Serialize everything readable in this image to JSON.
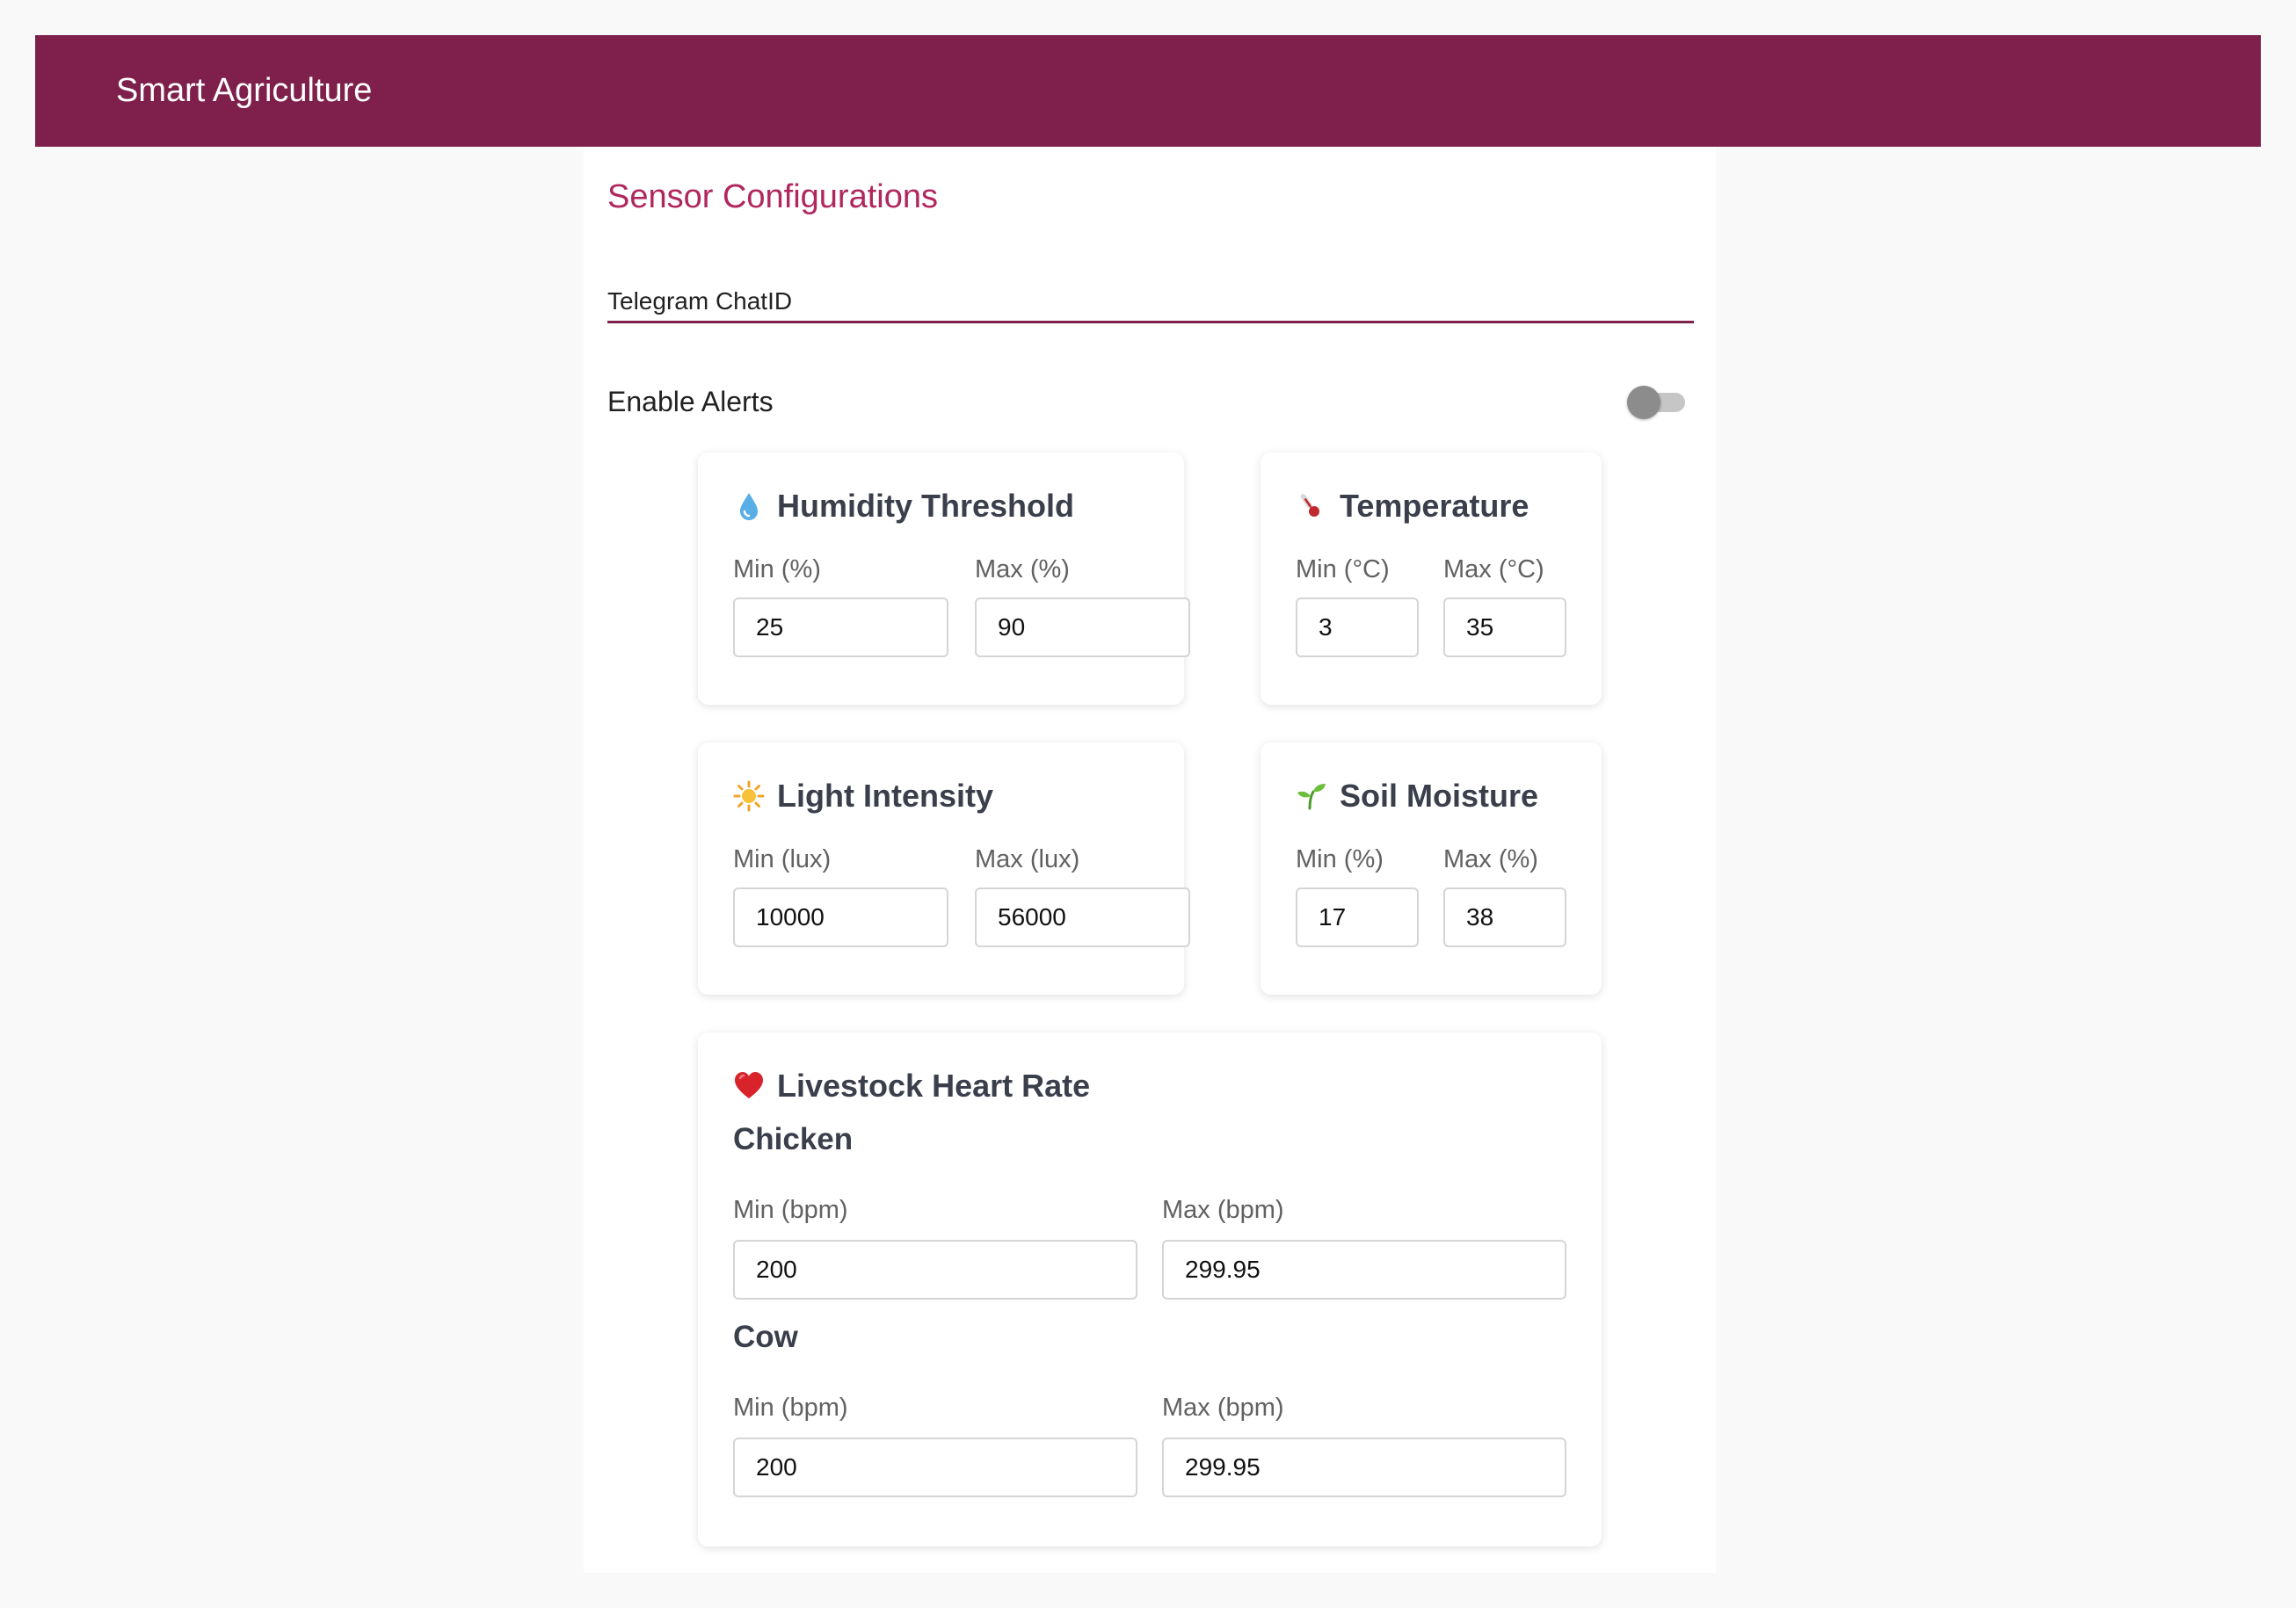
{
  "appbar": {
    "title": "Smart Agriculture"
  },
  "page": {
    "title": "Sensor Configurations"
  },
  "telegram": {
    "label": "Telegram ChatID",
    "value": ""
  },
  "alerts": {
    "label": "Enable Alerts",
    "enabled": false
  },
  "cards": {
    "humidity": {
      "icon": "droplet-icon",
      "title": "Humidity Threshold",
      "min_label": "Min (%)",
      "min_value": "25",
      "max_label": "Max (%)",
      "max_value": "90"
    },
    "temperature": {
      "icon": "thermometer-icon",
      "title": "Temperature",
      "min_label": "Min (°C)",
      "min_value": "3",
      "max_label": "Max (°C)",
      "max_value": "35"
    },
    "light": {
      "icon": "sun-icon",
      "title": "Light Intensity",
      "min_label": "Min (lux)",
      "min_value": "10000",
      "max_label": "Max (lux)",
      "max_value": "56000"
    },
    "soil": {
      "icon": "seedling-icon",
      "title": "Soil Moisture",
      "min_label": "Min (%)",
      "min_value": "17",
      "max_label": "Max (%)",
      "max_value": "38"
    },
    "heart": {
      "icon": "heart-icon",
      "title": "Livestock Heart Rate",
      "chicken": {
        "title": "Chicken",
        "min_label": "Min (bpm)",
        "min_value": "200",
        "max_label": "Max (bpm)",
        "max_value": "299.95"
      },
      "cow": {
        "title": "Cow",
        "min_label": "Min (bpm)",
        "min_value": "200",
        "max_label": "Max (bpm)",
        "max_value": "299.95"
      }
    }
  },
  "colors": {
    "primary": "#7e204b",
    "accent": "#b0275e",
    "background": "#f9f9f9",
    "card_title": "#3a3f4b"
  }
}
